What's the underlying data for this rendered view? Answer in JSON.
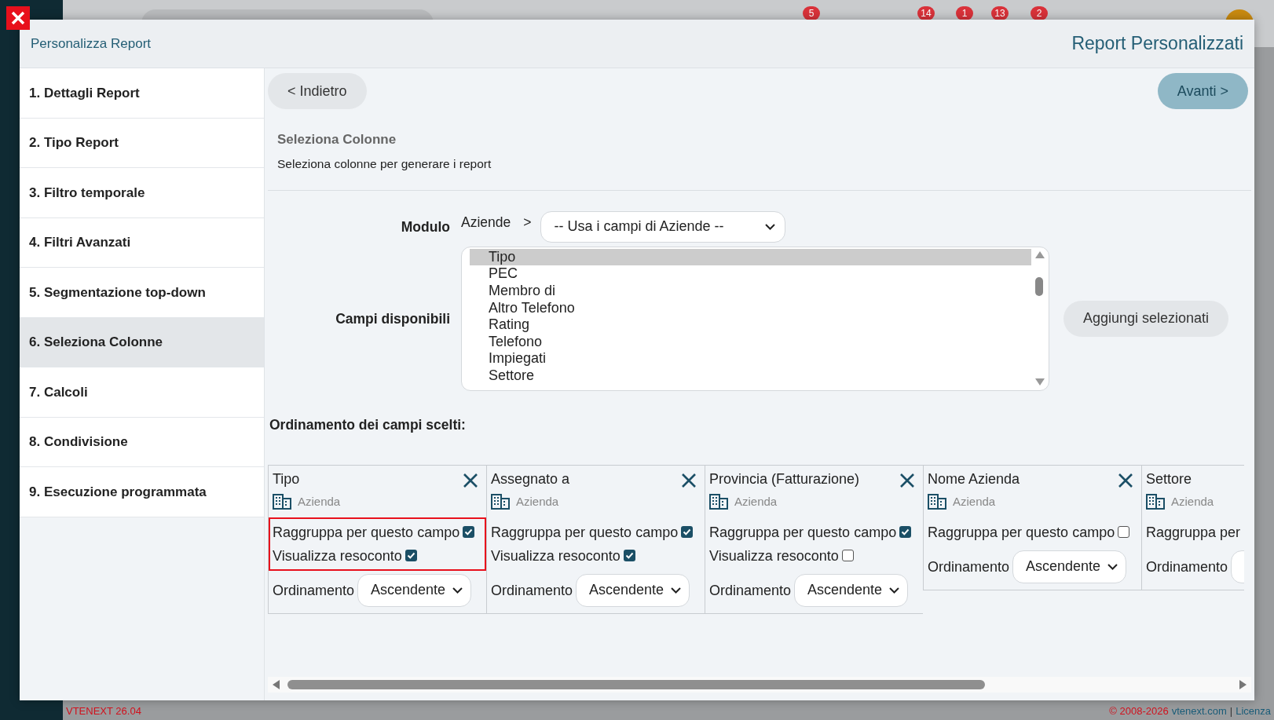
{
  "background": {
    "badges": [
      "5",
      "14",
      "1",
      "13",
      "2"
    ]
  },
  "modal": {
    "title": "Personalizza Report",
    "heading": "Report Personalizzati"
  },
  "steps": [
    {
      "label": "1. Dettagli Report",
      "selected": false
    },
    {
      "label": "2. Tipo Report",
      "selected": false
    },
    {
      "label": "3. Filtro temporale",
      "selected": false
    },
    {
      "label": "4. Filtri Avanzati",
      "selected": false
    },
    {
      "label": "5. Segmentazione top-down",
      "selected": false
    },
    {
      "label": "6. Seleziona Colonne",
      "selected": true
    },
    {
      "label": "7. Calcoli",
      "selected": false
    },
    {
      "label": "8. Condivisione",
      "selected": false
    },
    {
      "label": "9. Esecuzione programmata",
      "selected": false
    }
  ],
  "nav": {
    "back": "< Indietro",
    "next": "Avanti >"
  },
  "section": {
    "title": "Seleziona Colonne",
    "subtitle": "Seleziona colonne per generare i report"
  },
  "module": {
    "label": "Modulo",
    "name": "Aziende",
    "separator": ">",
    "select_value": "-- Usa i campi di Aziende --"
  },
  "available": {
    "label": "Campi disponibili",
    "add_button": "Aggiungi selezionati",
    "items": [
      {
        "label": "Tipo",
        "selected": true
      },
      {
        "label": "PEC",
        "selected": false
      },
      {
        "label": "Membro di",
        "selected": false
      },
      {
        "label": "Altro Telefono",
        "selected": false
      },
      {
        "label": "Rating",
        "selected": false
      },
      {
        "label": "Telefono",
        "selected": false
      },
      {
        "label": "Impiegati",
        "selected": false
      },
      {
        "label": "Settore",
        "selected": false
      }
    ]
  },
  "ordering": {
    "title": "Ordinamento dei campi scelti:",
    "columns": [
      {
        "title": "Tipo",
        "module": "Azienda",
        "removable": true,
        "highlighted": true,
        "options": [
          {
            "label": "Raggruppa per questo campo",
            "checked": true
          },
          {
            "label": "Visualizza resoconto",
            "checked": true
          }
        ],
        "order_label": "Ordinamento",
        "order_value": "Ascendente"
      },
      {
        "title": "Assegnato a",
        "module": "Azienda",
        "removable": true,
        "highlighted": false,
        "options": [
          {
            "label": "Raggruppa per questo campo",
            "checked": true
          },
          {
            "label": "Visualizza resoconto",
            "checked": true
          }
        ],
        "order_label": "Ordinamento",
        "order_value": "Ascendente"
      },
      {
        "title": "Provincia (Fatturazione)",
        "module": "Azienda",
        "removable": true,
        "highlighted": false,
        "options": [
          {
            "label": "Raggruppa per questo campo",
            "checked": true
          },
          {
            "label": "Visualizza resoconto",
            "checked": false
          }
        ],
        "order_label": "Ordinamento",
        "order_value": "Ascendente"
      },
      {
        "title": "Nome Azienda",
        "module": "Azienda",
        "removable": true,
        "highlighted": false,
        "options": [
          {
            "label": "Raggruppa per questo campo",
            "checked": false
          }
        ],
        "order_label": "Ordinamento",
        "order_value": "Ascendente"
      },
      {
        "title": "Settore",
        "module": "Azienda",
        "highlighted": false,
        "options": [
          {
            "label": "Raggruppa per"
          }
        ],
        "order_label": "Ordinamento"
      }
    ]
  },
  "footer": {
    "version": "VTENEXT 26.04",
    "copyright": "© 2008-2026",
    "site": "vtenext.com",
    "separator": "|",
    "license": "Licenza"
  }
}
